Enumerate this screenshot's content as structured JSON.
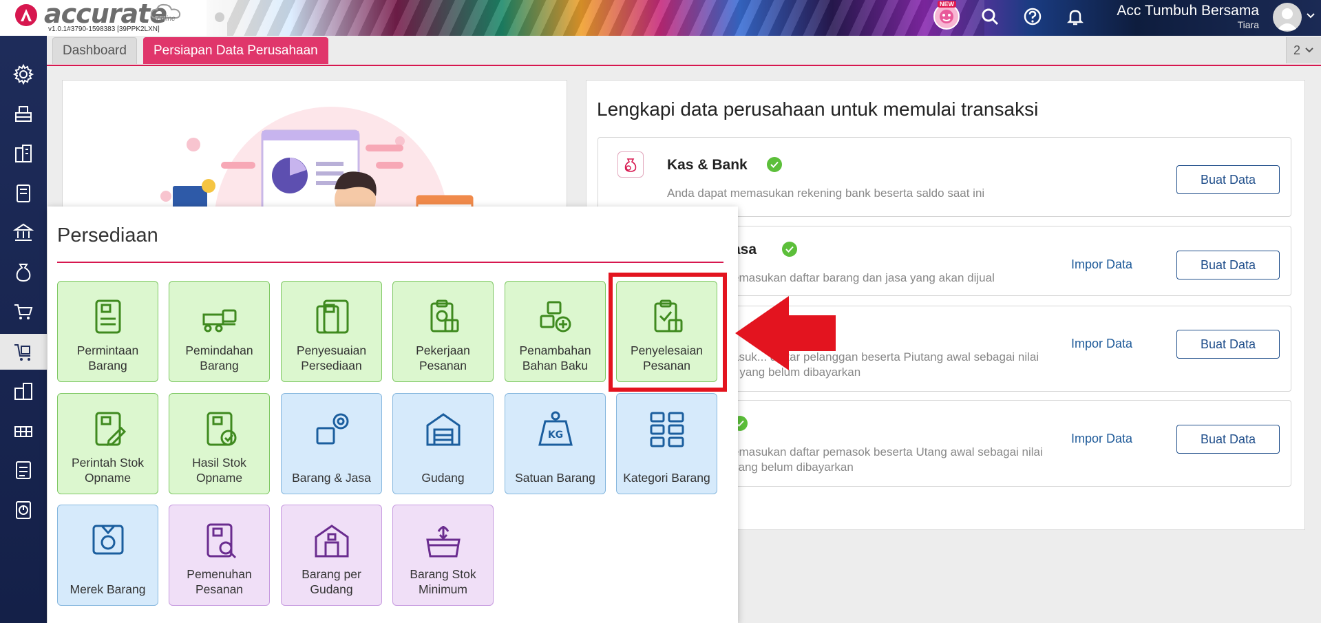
{
  "header": {
    "logo_text": "accurate",
    "logo_sub": "online",
    "version": "v1.0.1#3790-1598383 [39PPK2LXN]",
    "new_badge": "NEW",
    "company": "Acc Tumbuh Bersama",
    "user": "Tiara"
  },
  "tabs": {
    "dashboard": "Dashboard",
    "persiapan": "Persiapan Data Perusahaan",
    "count": "2"
  },
  "sidebar": {
    "items": [
      "settings-icon",
      "cashier-icon",
      "company-icon",
      "ledger-icon",
      "bank-icon",
      "money-bag-icon",
      "cart-icon",
      "inventory-icon",
      "building-icon",
      "warehouse-icon",
      "tax-icon",
      "report-icon"
    ]
  },
  "right_panel": {
    "title": "Lengkapi data perusahaan untuk memulai transaksi",
    "cards": [
      {
        "title": "Kas & Bank",
        "desc1": "Anda dapat memasukan rekening bank beserta saldo saat ini",
        "desc2": "",
        "impor": "",
        "buat": "Buat Data"
      },
      {
        "title": "asa",
        "desc1": "emasukan daftar barang dan jasa yang akan dijual",
        "desc2": "",
        "impor": "Impor Data",
        "buat": "Buat Data"
      },
      {
        "title": "",
        "desc1": "asuk... daftar pelanggan beserta Piutang awal sebagai nilai",
        "desc2": "r yang belum dibayarkan",
        "impor": "Impor Data",
        "buat": "Buat Data"
      },
      {
        "title": "",
        "desc1": "emasukan daftar pemasok beserta Utang awal sebagai nilai",
        "desc2": "yang belum dibayarkan",
        "impor": "Impor Data",
        "buat": "Buat Data"
      }
    ]
  },
  "popup": {
    "title": "Persediaan",
    "tiles": [
      {
        "line1": "Permintaan",
        "line2": "Barang",
        "color": "green"
      },
      {
        "line1": "Pemindahan",
        "line2": "Barang",
        "color": "green"
      },
      {
        "line1": "Penyesuaian",
        "line2": "Persediaan",
        "color": "green"
      },
      {
        "line1": "Pekerjaan",
        "line2": "Pesanan",
        "color": "green"
      },
      {
        "line1": "Penambahan",
        "line2": "Bahan Baku",
        "color": "green"
      },
      {
        "line1": "Penyelesaian",
        "line2": "Pesanan",
        "color": "green"
      },
      {
        "line1": "Perintah Stok",
        "line2": "Opname",
        "color": "green"
      },
      {
        "line1": "Hasil Stok",
        "line2": "Opname",
        "color": "green"
      },
      {
        "line1": "",
        "line2": "Barang & Jasa",
        "color": "blue"
      },
      {
        "line1": "",
        "line2": "Gudang",
        "color": "blue"
      },
      {
        "line1": "",
        "line2": "Satuan Barang",
        "color": "blue"
      },
      {
        "line1": "",
        "line2": "Kategori Barang",
        "color": "blue"
      },
      {
        "line1": "",
        "line2": "Merek Barang",
        "color": "blue"
      },
      {
        "line1": "Pemenuhan",
        "line2": "Pesanan",
        "color": "purple"
      },
      {
        "line1": "Barang per",
        "line2": "Gudang",
        "color": "purple"
      },
      {
        "line1": "Barang Stok",
        "line2": "Minimum",
        "color": "purple"
      }
    ],
    "kg_label": "KG"
  },
  "colors": {
    "accent": "#d7174f",
    "green_icon": "#3f8a1f",
    "blue_icon": "#1b5e9e",
    "purple_icon": "#6a2c8f",
    "highlight": "#e3141f"
  }
}
